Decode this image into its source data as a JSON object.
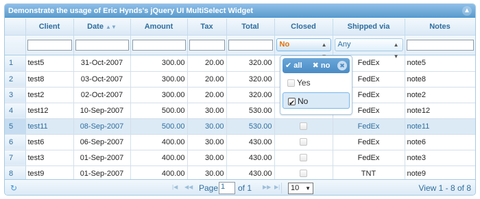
{
  "caption": {
    "title": "Demonstrate the usage of Eric Hynds's jQuery UI MultiSelect Widget",
    "close_icon": "circle-triangle-up-icon"
  },
  "columns": [
    "",
    "Client",
    "Date",
    "Amount",
    "Tax",
    "Total",
    "Closed",
    "Shipped via",
    "Notes"
  ],
  "sort_icon": "sort-arrows-icon",
  "filters": {
    "client": "",
    "date": "",
    "amount": "",
    "tax": "",
    "total": "",
    "closed": "No",
    "shipped": "Any",
    "notes": ""
  },
  "rows": [
    {
      "rn": "1",
      "client": "test5",
      "date": "31-Oct-2007",
      "amount": "300.00",
      "tax": "20.00",
      "total": "320.00",
      "shipped": "FedEx",
      "notes": "note5"
    },
    {
      "rn": "2",
      "client": "test8",
      "date": "03-Oct-2007",
      "amount": "300.00",
      "tax": "20.00",
      "total": "320.00",
      "shipped": "FedEx",
      "notes": "note8"
    },
    {
      "rn": "3",
      "client": "test2",
      "date": "02-Oct-2007",
      "amount": "300.00",
      "tax": "20.00",
      "total": "320.00",
      "shipped": "FedEx",
      "notes": "note2"
    },
    {
      "rn": "4",
      "client": "test12",
      "date": "10-Sep-2007",
      "amount": "500.00",
      "tax": "30.00",
      "total": "530.00",
      "shipped": "FedEx",
      "notes": "note12"
    },
    {
      "rn": "5",
      "client": "test11",
      "date": "08-Sep-2007",
      "amount": "500.00",
      "tax": "30.00",
      "total": "530.00",
      "shipped": "FedEx",
      "notes": "note11"
    },
    {
      "rn": "6",
      "client": "test6",
      "date": "06-Sep-2007",
      "amount": "400.00",
      "tax": "30.00",
      "total": "430.00",
      "shipped": "FedEx",
      "notes": "note6"
    },
    {
      "rn": "7",
      "client": "test3",
      "date": "01-Sep-2007",
      "amount": "400.00",
      "tax": "30.00",
      "total": "430.00",
      "shipped": "FedEx",
      "notes": "note3"
    },
    {
      "rn": "8",
      "client": "test9",
      "date": "01-Sep-2007",
      "amount": "400.00",
      "tax": "30.00",
      "total": "430.00",
      "shipped": "TNT",
      "notes": "note9"
    }
  ],
  "multiselect": {
    "check_all": "all",
    "uncheck_all": "no",
    "options": [
      "Yes",
      "No"
    ],
    "selected": "No"
  },
  "pager": {
    "page_label": "Page",
    "page_value": "1",
    "of_label": "of 1",
    "rows_per_page": "10",
    "view_text": "View 1 - 8 of 8",
    "refresh_icon": "refresh-icon"
  }
}
